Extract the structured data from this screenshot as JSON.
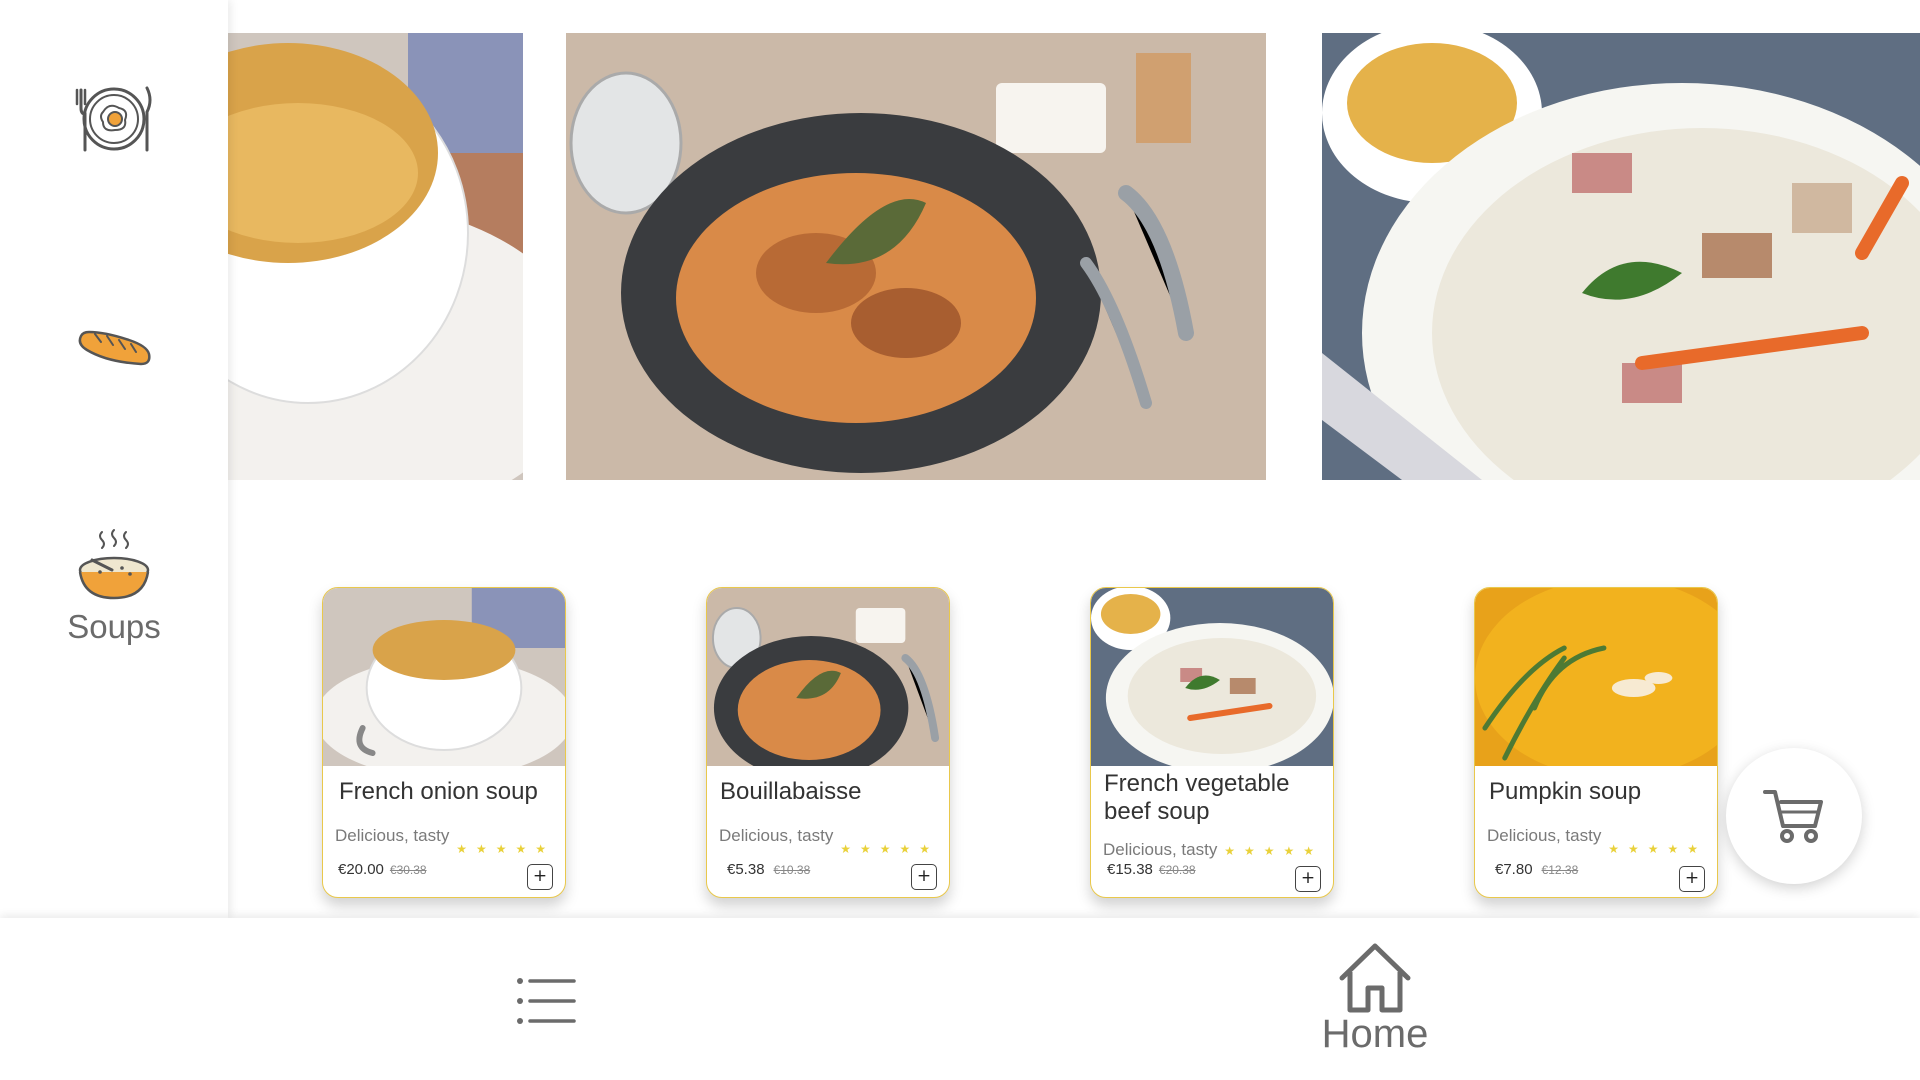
{
  "sidebar": {
    "items": [
      {
        "icon": "breakfast-plate-icon",
        "label": ""
      },
      {
        "icon": "bread-icon",
        "label": ""
      },
      {
        "icon": "soup-bowl-icon",
        "label": "Soups"
      }
    ]
  },
  "banners": [
    {
      "name": "French onion soup"
    },
    {
      "name": "Bouillabaisse"
    },
    {
      "name": "French vegetable beef soup"
    }
  ],
  "products": [
    {
      "title": "French onion soup",
      "description": "Delicious, tasty",
      "price": "€20.00",
      "old_price": "€30.38",
      "stars": "★★★★★",
      "add_label": "+"
    },
    {
      "title": "Bouillabaisse",
      "description": "Delicious, tasty",
      "price": "€5.38",
      "old_price": "€10.38",
      "stars": "★★★★★",
      "add_label": "+"
    },
    {
      "title": "French vegetable beef soup",
      "description": "Delicious, tasty",
      "price": "€15.38",
      "old_price": "€20.38",
      "stars": "★★★★★",
      "add_label": "+"
    },
    {
      "title": "Pumpkin soup",
      "description": "Delicious, tasty",
      "price": "€7.80",
      "old_price": "€12.38",
      "stars": "★★★★★",
      "add_label": "+"
    }
  ],
  "cart": {
    "icon": "cart-icon"
  },
  "bottom_nav": {
    "menu_icon": "list-icon",
    "home_icon": "home-icon",
    "home_label": "Home"
  },
  "colors": {
    "card_border": "#e9c84b",
    "star": "#e9d13a",
    "icon_gray": "#6b6b6b",
    "accent_orange": "#f0a23a"
  }
}
